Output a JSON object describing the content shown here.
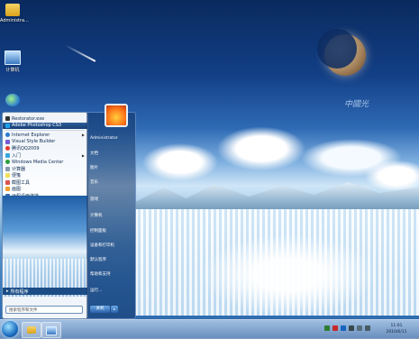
{
  "desktop": {
    "watermark": "中國光",
    "icons": [
      {
        "label": "Administra...",
        "icon": "folder-icon"
      },
      {
        "label": "计算机",
        "icon": "computer-icon"
      },
      {
        "label": "",
        "icon": "internet-explorer-icon"
      }
    ]
  },
  "start_menu": {
    "pinned": [
      {
        "label": "Restorator.exe",
        "icon": "restorator-icon"
      },
      {
        "label": "Adobe Photoshop CS3",
        "icon": "photoshop-icon"
      }
    ],
    "items": [
      {
        "label": "Internet Explorer",
        "icon": "internet-explorer-icon",
        "submenu": true
      },
      {
        "label": "Visual Style Builder",
        "icon": "visual-style-builder-icon",
        "submenu": false
      },
      {
        "label": "腾讯QQ2009",
        "icon": "qq-icon",
        "submenu": false
      },
      {
        "label": "入门",
        "icon": "getting-started-icon",
        "submenu": true
      },
      {
        "label": "Windows Media Center",
        "icon": "media-center-icon",
        "submenu": false
      },
      {
        "label": "计算器",
        "icon": "calculator-icon",
        "submenu": false
      },
      {
        "label": "便笺",
        "icon": "sticky-notes-icon",
        "submenu": false
      },
      {
        "label": "截图工具",
        "icon": "snipping-tool-icon",
        "submenu": false
      },
      {
        "label": "画图",
        "icon": "paint-icon",
        "submenu": false
      },
      {
        "label": "远程桌面连接",
        "icon": "remote-desktop-icon",
        "submenu": false
      }
    ],
    "all_programs": "所有程序",
    "search_placeholder": "搜索程序和文件",
    "right_items": [
      "Administrator",
      "文档",
      "图片",
      "音乐",
      "游戏",
      "计算机",
      "控制面板",
      "设备和打印机",
      "默认程序",
      "帮助和支持",
      "运行..."
    ],
    "shutdown_label": "关机",
    "shutdown_arrow": "▸"
  },
  "taskbar": {
    "clock_time": "11:01",
    "clock_date": "2010/6/11",
    "colors": {
      "accent": "#1d6fc3",
      "highlight": "#173f74"
    }
  }
}
